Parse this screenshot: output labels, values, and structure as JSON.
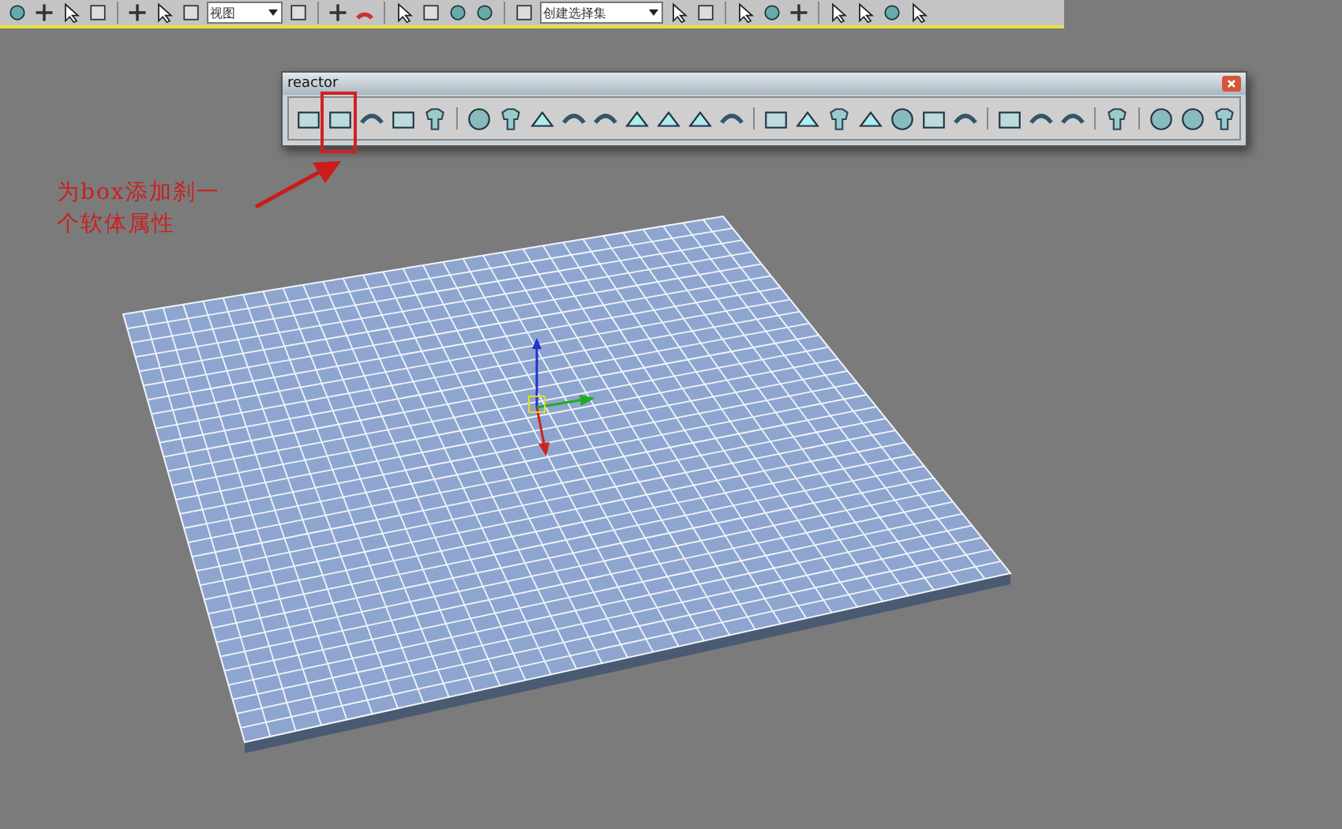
{
  "main_toolbar": {
    "dropdowns": [
      {
        "value": "视图"
      },
      {
        "value": "创建选择集"
      }
    ]
  },
  "reactor_toolbar": {
    "title": "reactor"
  },
  "annotation": {
    "lines": [
      "为box添加刹一",
      "个软体属性"
    ]
  }
}
